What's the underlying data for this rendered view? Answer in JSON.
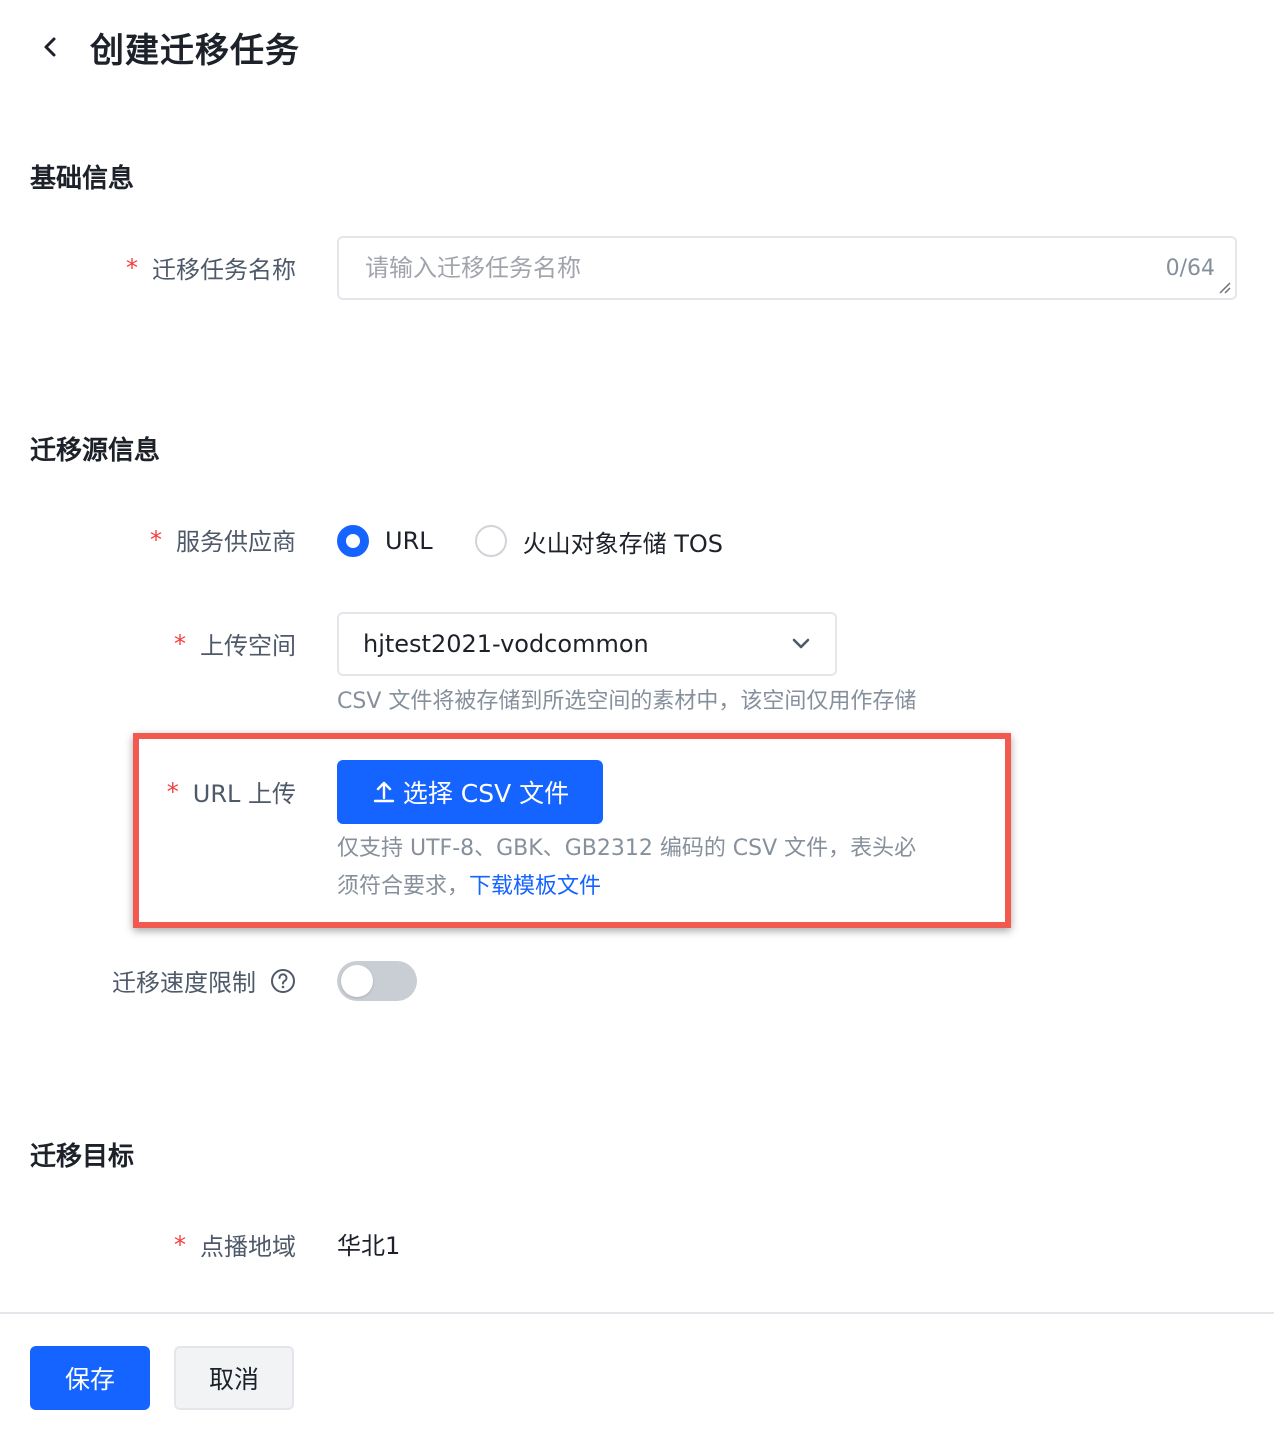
{
  "header": {
    "title": "创建迁移任务"
  },
  "sections": {
    "basic": "基础信息",
    "source": "迁移源信息",
    "target": "迁移目标"
  },
  "fields": {
    "task_name": {
      "label": "迁移任务名称",
      "placeholder": "请输入迁移任务名称",
      "value": "",
      "counter": "0/64"
    },
    "provider": {
      "label": "服务供应商",
      "options": [
        "URL",
        "火山对象存储 TOS"
      ],
      "selected": "URL"
    },
    "upload_space": {
      "label": "上传空间",
      "value": "hjtest2021-vodcommon",
      "help": "CSV 文件将被存储到所选空间的素材中，该空间仅用作存储"
    },
    "url_upload": {
      "label": "URL 上传",
      "button": "选择 CSV 文件",
      "help_line1": "仅支持 UTF-8、GBK、GB2312 编码的 CSV 文件，表头必",
      "help_line2": "须符合要求，",
      "link": "下载模板文件"
    },
    "speed_limit": {
      "label": "迁移速度限制",
      "enabled": false
    },
    "region": {
      "label": "点播地域",
      "value": "华北1"
    }
  },
  "footer": {
    "save": "保存",
    "cancel": "取消"
  },
  "colors": {
    "primary": "#1664ff",
    "required": "#f53f3f",
    "highlight": "#f25a4f"
  }
}
